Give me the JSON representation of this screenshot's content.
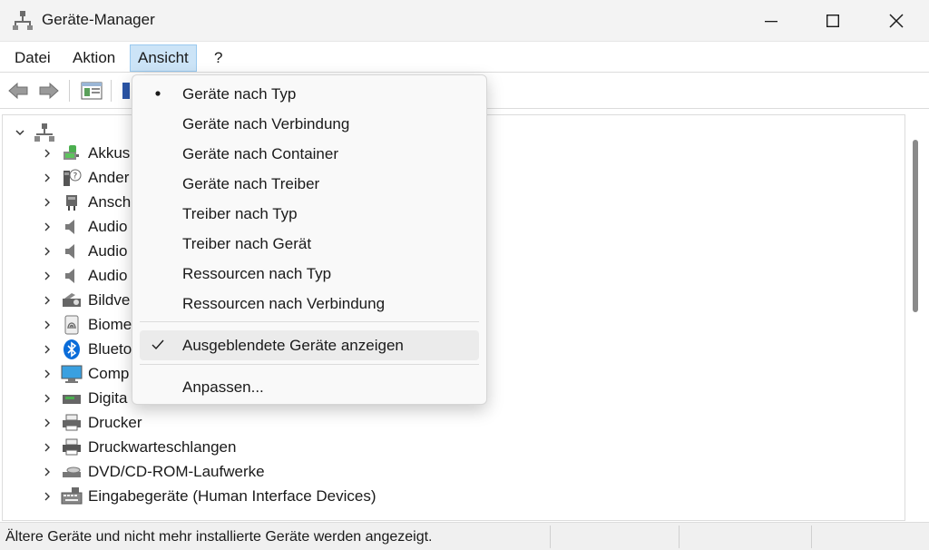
{
  "window": {
    "title": "Geräte-Manager"
  },
  "menubar": {
    "items": [
      {
        "label": "Datei"
      },
      {
        "label": "Aktion"
      },
      {
        "label": "Ansicht"
      },
      {
        "label": "?"
      }
    ],
    "active": "Ansicht"
  },
  "view_menu": {
    "items": [
      {
        "label": "Geräte nach Typ",
        "mark": "bullet"
      },
      {
        "label": "Geräte nach Verbindung",
        "mark": ""
      },
      {
        "label": "Geräte nach Container",
        "mark": ""
      },
      {
        "label": "Geräte nach Treiber",
        "mark": ""
      },
      {
        "label": "Treiber nach Typ",
        "mark": ""
      },
      {
        "label": "Treiber nach Gerät",
        "mark": ""
      },
      {
        "label": "Ressourcen nach Typ",
        "mark": ""
      },
      {
        "label": "Ressourcen nach Verbindung",
        "mark": ""
      },
      {
        "label": "Ausgeblendete Geräte anzeigen",
        "mark": "check",
        "hovered": true
      },
      {
        "label": "Anpassen...",
        "mark": ""
      }
    ]
  },
  "tree": {
    "rows": [
      {
        "label": "Akkus",
        "icon": "battery-icon"
      },
      {
        "label": "Ander",
        "icon": "unknown-device-icon"
      },
      {
        "label": "Ansch",
        "icon": "port-connector-icon"
      },
      {
        "label": "Audio",
        "icon": "speaker-icon"
      },
      {
        "label": "Audio",
        "icon": "speaker-icon"
      },
      {
        "label": "Audio",
        "icon": "speaker-icon"
      },
      {
        "label": "Bildve",
        "icon": "camera-icon"
      },
      {
        "label": "Biome",
        "icon": "fingerprint-icon"
      },
      {
        "label": "Blueto",
        "icon": "bluetooth-icon"
      },
      {
        "label": "Comp",
        "icon": "monitor-icon"
      },
      {
        "label": "Digita",
        "icon": "media-device-icon"
      },
      {
        "label": "Drucker",
        "icon": "printer-icon"
      },
      {
        "label": "Druckwarteschlangen",
        "icon": "print-queue-icon"
      },
      {
        "label": "DVD/CD-ROM-Laufwerke",
        "icon": "dvd-drive-icon"
      },
      {
        "label": "Eingabegeräte (Human Interface Devices)",
        "icon": "hid-keyboard-icon"
      }
    ]
  },
  "status": {
    "text": "Ältere Geräte und nicht mehr installierte Geräte werden angezeigt."
  },
  "colors": {
    "menu_active_bg": "#cce4f7",
    "menu_active_border": "#99c9ef",
    "bluetooth": "#0a6cd9"
  }
}
